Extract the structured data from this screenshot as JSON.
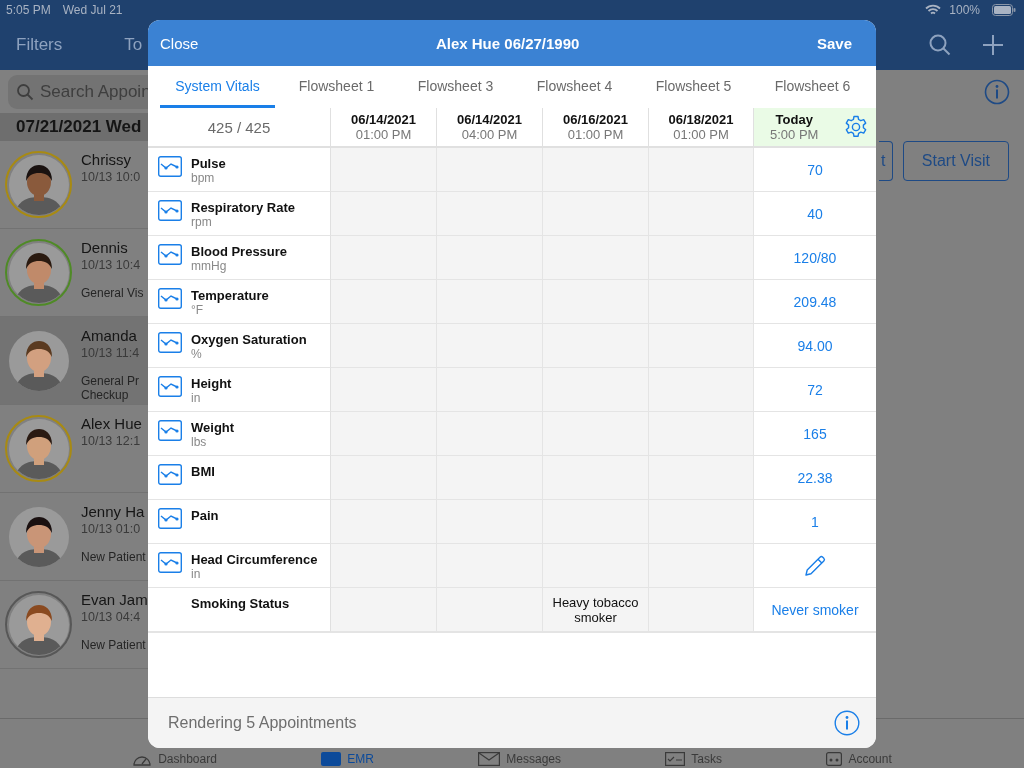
{
  "status_bar": {
    "time": "5:05 PM",
    "date": "Wed Jul 21",
    "battery": "100%"
  },
  "nav": {
    "left": "Filters",
    "cut_title": "To"
  },
  "search": {
    "placeholder": "Search Appoin"
  },
  "list_date": "07/21/2021 Wed",
  "appointments": [
    {
      "name": "Chrissy",
      "time": "10/13 10:0",
      "color": "#a88a12",
      "selected": false
    },
    {
      "name": "Dennis",
      "time": "10/13 10:4",
      "note": [
        "General Vis"
      ],
      "color": "#4f8a26",
      "selected": false
    },
    {
      "name": "Amanda",
      "time": "10/13 11:4",
      "note": [
        "General Pr",
        "Checkup"
      ],
      "selected": true
    },
    {
      "name": "Alex Hue",
      "time": "10/13 12:1",
      "color": "#a88a12",
      "selected": false
    },
    {
      "name": "Jenny Ha",
      "time": "10/13 01:0",
      "note": [
        "New Patient"
      ],
      "selected": false
    },
    {
      "name": "Evan Jam",
      "time": "10/13 04:4",
      "note": [
        "New Patient"
      ],
      "color": "#575757",
      "selected": false
    }
  ],
  "right_buttons": [
    "t",
    "Start Visit"
  ],
  "tab_bar": [
    {
      "label": "Dashboard",
      "selected": false,
      "kind": "gauge"
    },
    {
      "label": "EMR",
      "selected": true,
      "kind": "emr"
    },
    {
      "label": "Messages",
      "selected": false,
      "kind": "mail"
    },
    {
      "label": "Tasks",
      "selected": false,
      "kind": "tasks"
    },
    {
      "label": "Account",
      "selected": false,
      "kind": "account"
    }
  ],
  "modal": {
    "close": "Close",
    "title": "Alex Hue 06/27/1990",
    "save": "Save",
    "tabs": [
      {
        "label": "System Vitals",
        "selected": true
      },
      {
        "label": "Flowsheet 1",
        "selected": false
      },
      {
        "label": "Flowsheet 3",
        "selected": false
      },
      {
        "label": "Flowsheet 4",
        "selected": false
      },
      {
        "label": "Flowsheet 5",
        "selected": false
      },
      {
        "label": "Flowsheet 6",
        "selected": false
      }
    ],
    "counter": "425 / 425",
    "columns": [
      {
        "date": "06/14/2021",
        "time": "01:00 PM"
      },
      {
        "date": "06/14/2021",
        "time": "04:00 PM"
      },
      {
        "date": "06/16/2021",
        "time": "01:00 PM"
      },
      {
        "date": "06/18/2021",
        "time": "01:00 PM"
      }
    ],
    "today": {
      "date": "Today",
      "time": "5:00 PM"
    },
    "rows": [
      {
        "label": "Pulse",
        "unit": "bpm",
        "kind": "trend",
        "cells": [
          null,
          null,
          null,
          null
        ],
        "today": {
          "kind": "value",
          "text": "70"
        }
      },
      {
        "label": "Respiratory Rate",
        "unit": "rpm",
        "kind": "trend",
        "cells": [
          null,
          null,
          null,
          null
        ],
        "today": {
          "kind": "value",
          "text": "40"
        }
      },
      {
        "label": "Blood Pressure",
        "unit": "mmHg",
        "kind": "trend",
        "cells": [
          null,
          null,
          null,
          null
        ],
        "today": {
          "kind": "value",
          "text": "120/80"
        }
      },
      {
        "label": "Temperature",
        "unit": "°F",
        "kind": "trend",
        "cells": [
          null,
          null,
          null,
          null
        ],
        "today": {
          "kind": "value",
          "text": "209.48"
        }
      },
      {
        "label": "Oxygen Saturation",
        "unit": "%",
        "kind": "trend",
        "cells": [
          null,
          null,
          null,
          null
        ],
        "today": {
          "kind": "value",
          "text": "94.00"
        }
      },
      {
        "label": "Height",
        "unit": "in",
        "kind": "trend",
        "cells": [
          null,
          null,
          null,
          null
        ],
        "today": {
          "kind": "value",
          "text": "72"
        }
      },
      {
        "label": "Weight",
        "unit": "lbs",
        "kind": "trend",
        "cells": [
          null,
          null,
          null,
          null
        ],
        "today": {
          "kind": "value",
          "text": "165"
        }
      },
      {
        "label": "BMI",
        "kind": "trend",
        "cells": [
          null,
          null,
          null,
          null
        ],
        "today": {
          "kind": "value",
          "text": "22.38"
        }
      },
      {
        "label": "Pain",
        "kind": "trend",
        "cells": [
          null,
          null,
          null,
          null
        ],
        "today": {
          "kind": "value",
          "text": "1"
        }
      },
      {
        "label": "Head Circumference",
        "unit": "in",
        "kind": "trend",
        "cells": [
          null,
          null,
          null,
          null
        ],
        "today": {
          "kind": "edit"
        }
      },
      {
        "label": "Smoking Status",
        "kind": "plain",
        "cells": [
          null,
          null,
          "Heavy tobacco smoker",
          null
        ],
        "today": {
          "kind": "value",
          "text": "Never smoker"
        }
      }
    ],
    "footer": "Rendering 5 Appointments"
  }
}
